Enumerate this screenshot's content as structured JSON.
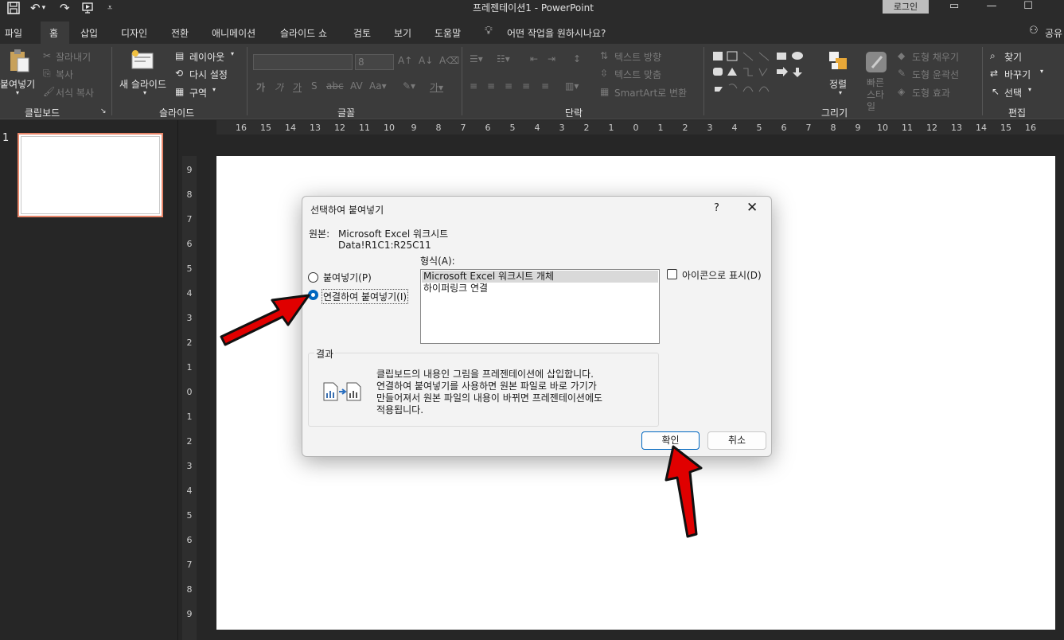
{
  "titlebar": {
    "doc_title": "프레젠테이션1  -  PowerPoint",
    "login": "로그인"
  },
  "tabs": [
    "파일",
    "홈",
    "삽입",
    "디자인",
    "전환",
    "애니메이션",
    "슬라이드 쇼",
    "검토",
    "보기",
    "도움말"
  ],
  "tell_me": "어떤 작업을 원하시나요?",
  "share": "공유",
  "ribbon": {
    "clipboard": {
      "paste": "붙여넣기",
      "cut": "잘라내기",
      "copy": "복사",
      "format_painter": "서식 복사",
      "label": "클립보드"
    },
    "slides": {
      "new_slide": "새 슬라이드",
      "layout": "레이아웃",
      "reset": "다시 설정",
      "section": "구역",
      "label": "슬라이드"
    },
    "font": {
      "size": "8",
      "label": "글꼴"
    },
    "paragraph": {
      "text_direction": "텍스트 방향",
      "align_text": "텍스트 맞춤",
      "smartart": "SmartArt로 변환",
      "label": "단락"
    },
    "drawing": {
      "arrange": "정렬",
      "quick_styles": "빠른 스타일",
      "fill": "도형 채우기",
      "outline": "도형 윤곽선",
      "effects": "도형 효과",
      "label": "그리기"
    },
    "editing": {
      "find": "찾기",
      "replace": "바꾸기",
      "select": "선택",
      "label": "편집"
    }
  },
  "thumbnails": {
    "slide_number": "1"
  },
  "dialog": {
    "title": "선택하여 붙여넣기",
    "help": "?",
    "source_label": "원본:",
    "source_name": "Microsoft Excel 워크시트",
    "source_range": "Data!R1C1:R25C11",
    "as_label": "형식(A):",
    "paste_option": "붙여넣기(P)",
    "paste_link_option": "연결하여 붙여넣기(I)",
    "formats": [
      "Microsoft Excel 워크시트 개체",
      "하이퍼링크 연결"
    ],
    "display_as_icon": "아이콘으로 표시(D)",
    "result_label": "결과",
    "result_text": [
      "클립보드의 내용인 그림을 프레젠테이션에 삽입합니다.",
      "연결하여 붙여넣기를 사용하면 원본 파일로 바로 가기가",
      "만들어져서 원본 파일의 내용이 바뀌면 프레젠테이션에도",
      "적용됩니다."
    ],
    "ok": "확인",
    "cancel": "취소"
  },
  "colors": {
    "accent": "#0067c0",
    "arrow_red": "#e00000",
    "slide_selected_border": "#e8866a"
  }
}
